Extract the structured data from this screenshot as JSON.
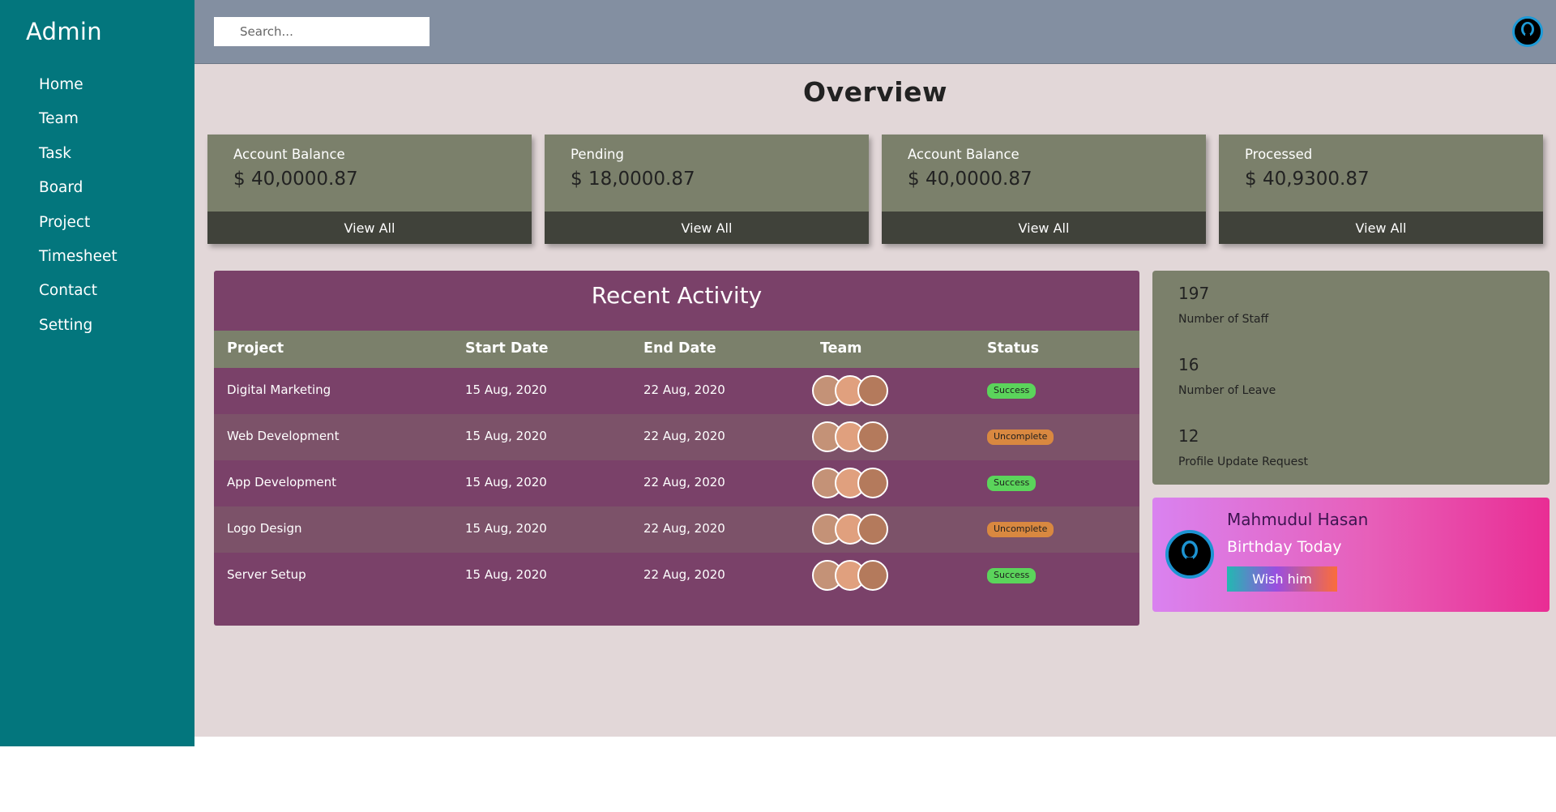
{
  "sidebar": {
    "brand": "Admin",
    "items": [
      "Home",
      "Team",
      "Task",
      "Board",
      "Project",
      "Timesheet",
      "Contact",
      "Setting"
    ]
  },
  "topbar": {
    "search_placeholder": "Search..."
  },
  "overview": {
    "title": "Overview",
    "cards": [
      {
        "label": "Account Balance",
        "value": "$ 40,0000.87",
        "button": "View All"
      },
      {
        "label": "Pending",
        "value": "$ 18,0000.87",
        "button": "View All"
      },
      {
        "label": "Account Balance",
        "value": "$ 40,0000.87",
        "button": "View All"
      },
      {
        "label": "Processed",
        "value": "$ 40,9300.87",
        "button": "View All"
      }
    ]
  },
  "activity": {
    "title": "Recent Activity",
    "headers": [
      "Project",
      "Start Date",
      "End Date",
      "Team",
      "Status"
    ],
    "rows": [
      {
        "project": "Digital Marketing",
        "start": "15 Aug, 2020",
        "end": "22 Aug, 2020",
        "status": "Success"
      },
      {
        "project": "Web Development",
        "start": "15 Aug, 2020",
        "end": "22 Aug, 2020",
        "status": "Uncomplete"
      },
      {
        "project": "App Development",
        "start": "15 Aug, 2020",
        "end": "22 Aug, 2020",
        "status": "Success"
      },
      {
        "project": "Logo Design",
        "start": "15 Aug, 2020",
        "end": "22 Aug, 2020",
        "status": "Uncomplete"
      },
      {
        "project": "Server Setup",
        "start": "15 Aug, 2020",
        "end": "22 Aug, 2020",
        "status": "Success"
      }
    ]
  },
  "stats": [
    {
      "value": "197",
      "label": "Number of Staff"
    },
    {
      "value": "16",
      "label": "Number of Leave"
    },
    {
      "value": "12",
      "label": "Profile Update Request"
    }
  ],
  "birthday": {
    "name": "Mahmudul Hasan",
    "subtitle": "Birthday Today",
    "button": "Wish him"
  },
  "colors": {
    "sidebar": "#03767d",
    "topbar": "#838fa1",
    "background": "#e2d7d8",
    "card": "#7b806b",
    "card_button": "#40423a",
    "activity": "#7a4169",
    "success": "#5bd45b",
    "uncomplete": "#d98840"
  }
}
